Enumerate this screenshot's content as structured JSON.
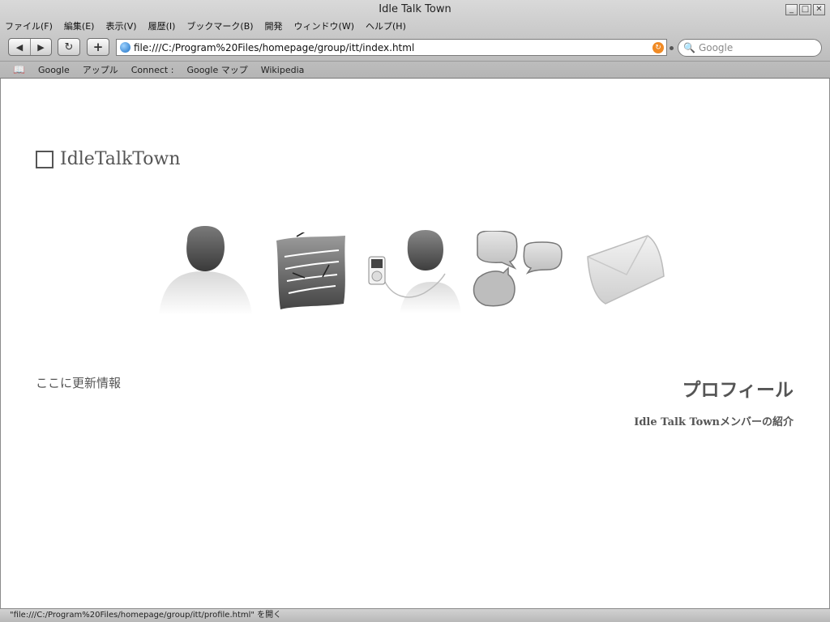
{
  "window": {
    "title": "Idle Talk Town"
  },
  "window_buttons": [
    "_",
    "□",
    "✕"
  ],
  "menu": [
    "ファイル(F)",
    "編集(E)",
    "表示(V)",
    "履歴(I)",
    "ブックマーク(B)",
    "開発",
    "ウィンドウ(W)",
    "ヘルプ(H)"
  ],
  "toolbar": {
    "back": "◀",
    "forward": "▶",
    "reload": "↻",
    "new_tab": "+",
    "url": "file:///C:/Program%20Files/homepage/group/itt/index.html",
    "rss": "↻",
    "search_icon": "🔍",
    "search_placeholder": "Google"
  },
  "bookmarks": {
    "book_icon": "📖",
    "items": [
      "Google",
      "アップル",
      "Connect :",
      "Google マップ",
      "Wikipedia"
    ]
  },
  "page": {
    "logo_text": "IdleTalkTown",
    "nav_icons": [
      "person-icon",
      "notes-icon",
      "music-player-person-icon",
      "chat-bubbles-icon",
      "envelope-icon"
    ],
    "updates": "ここに更新情報",
    "profile_title": "プロフィール",
    "profile_subtitle": "Idle Talk Townメンバーの紹介"
  },
  "status": "\"file:///C:/Program%20Files/homepage/group/itt/profile.html\" を開く"
}
